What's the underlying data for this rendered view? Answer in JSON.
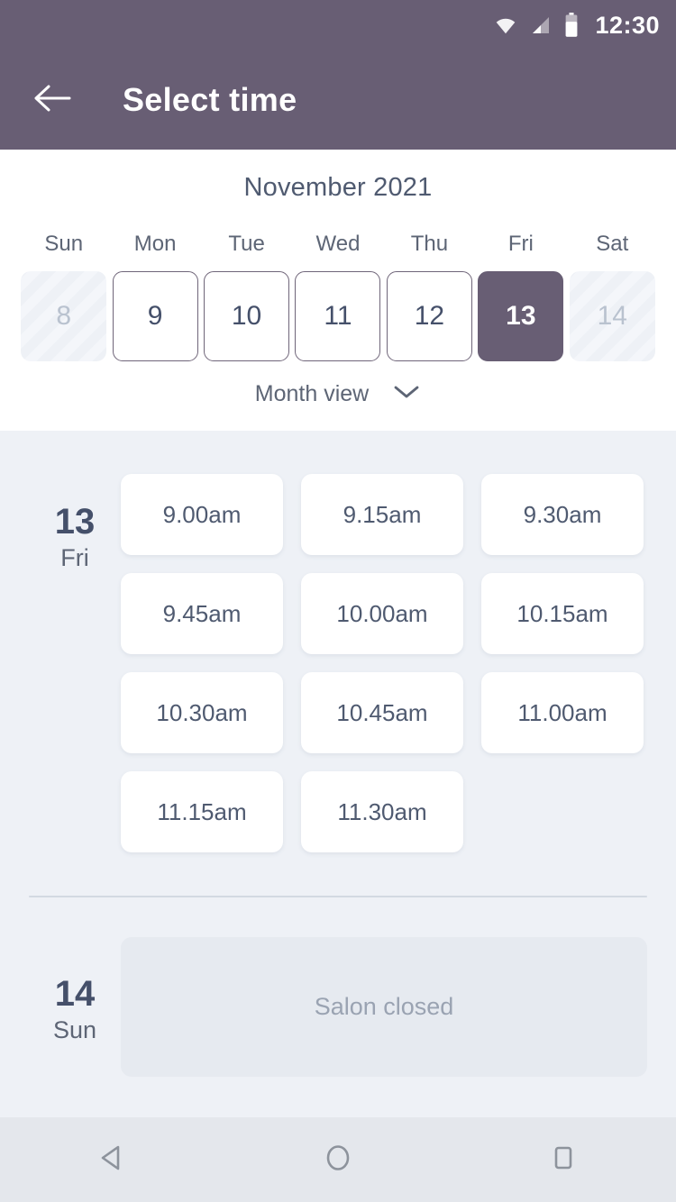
{
  "statusbar": {
    "time": "12:30",
    "icons": [
      "wifi-icon",
      "cellular-signal-icon",
      "battery-icon"
    ]
  },
  "appbar": {
    "back_icon": "back-arrow-icon",
    "title": "Select time"
  },
  "calendar": {
    "month_title": "November 2021",
    "weekdays": [
      "Sun",
      "Mon",
      "Tue",
      "Wed",
      "Thu",
      "Fri",
      "Sat"
    ],
    "days": [
      {
        "num": "8",
        "state": "disabled"
      },
      {
        "num": "9",
        "state": "enabled"
      },
      {
        "num": "10",
        "state": "enabled"
      },
      {
        "num": "11",
        "state": "enabled"
      },
      {
        "num": "12",
        "state": "enabled"
      },
      {
        "num": "13",
        "state": "selected"
      },
      {
        "num": "14",
        "state": "disabled"
      }
    ],
    "view_toggle_label": "Month view",
    "view_toggle_icon": "chevron-down-icon"
  },
  "schedule": [
    {
      "date_num": "13",
      "date_dow": "Fri",
      "slots": [
        "9.00am",
        "9.15am",
        "9.30am",
        "9.45am",
        "10.00am",
        "10.15am",
        "10.30am",
        "10.45am",
        "11.00am",
        "11.15am",
        "11.30am"
      ]
    },
    {
      "date_num": "14",
      "date_dow": "Sun",
      "closed_label": "Salon closed"
    }
  ],
  "navbar": {
    "back_icon": "nav-back-triangle-icon",
    "home_icon": "nav-home-circle-icon",
    "recents_icon": "nav-recents-square-icon"
  },
  "colors": {
    "brand_purple": "#685e74",
    "slot_bg": "#eef1f6",
    "text_dark": "#45506a",
    "text_muted": "#5d6575",
    "closed_card": "#e6eaf0"
  }
}
